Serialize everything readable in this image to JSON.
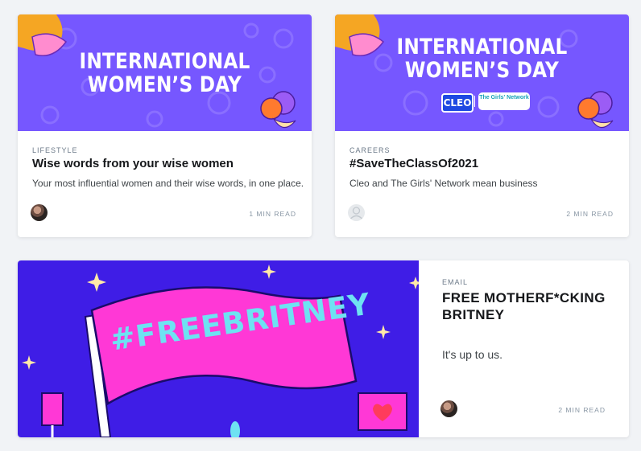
{
  "posts": [
    {
      "banner_lines": [
        "INTERNATIONAL",
        "WOMEN’S DAY"
      ],
      "tag": "LIFESTYLE",
      "title": "Wise words from your wise women",
      "excerpt": "Your most influential women and their wise words, in one place.",
      "read_time": "1 MIN READ"
    },
    {
      "banner_lines": [
        "INTERNATIONAL",
        "WOMEN’S DAY"
      ],
      "logo_cleo": "CLEO",
      "logo_girls_network": "The Girls' Network",
      "tag": "CAREERS",
      "title": "#SaveTheClassOf2021",
      "excerpt": "Cleo and The Girls' Network mean business",
      "read_time": "2 MIN READ"
    },
    {
      "flag_text": "#FREEBRITNEY",
      "tag": "EMAIL",
      "title": "FREE MOTHERF*CKING BRITNEY",
      "excerpt": "It's up to us.",
      "read_time": "2 MIN READ"
    }
  ],
  "colors": {
    "banner_purple": "#7657ff",
    "hero_blue": "#3f1de6",
    "flag_pink": "#ff38d6",
    "flag_text": "#6ee2f2"
  }
}
